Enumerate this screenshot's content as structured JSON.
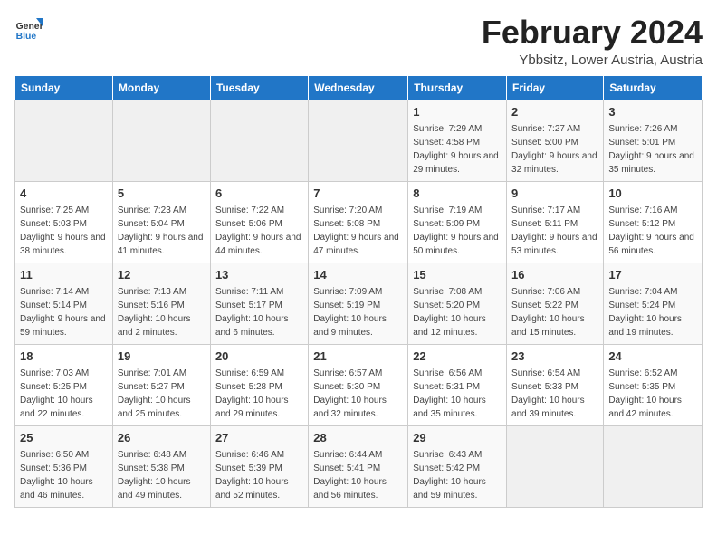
{
  "logo": {
    "general": "General",
    "blue": "Blue"
  },
  "header": {
    "month": "February 2024",
    "location": "Ybbsitz, Lower Austria, Austria"
  },
  "weekdays": [
    "Sunday",
    "Monday",
    "Tuesday",
    "Wednesday",
    "Thursday",
    "Friday",
    "Saturday"
  ],
  "weeks": [
    [
      {
        "day": "",
        "sunrise": "",
        "sunset": "",
        "daylight": "",
        "empty": true
      },
      {
        "day": "",
        "sunrise": "",
        "sunset": "",
        "daylight": "",
        "empty": true
      },
      {
        "day": "",
        "sunrise": "",
        "sunset": "",
        "daylight": "",
        "empty": true
      },
      {
        "day": "",
        "sunrise": "",
        "sunset": "",
        "daylight": "",
        "empty": true
      },
      {
        "day": "1",
        "sunrise": "Sunrise: 7:29 AM",
        "sunset": "Sunset: 4:58 PM",
        "daylight": "Daylight: 9 hours and 29 minutes."
      },
      {
        "day": "2",
        "sunrise": "Sunrise: 7:27 AM",
        "sunset": "Sunset: 5:00 PM",
        "daylight": "Daylight: 9 hours and 32 minutes."
      },
      {
        "day": "3",
        "sunrise": "Sunrise: 7:26 AM",
        "sunset": "Sunset: 5:01 PM",
        "daylight": "Daylight: 9 hours and 35 minutes."
      }
    ],
    [
      {
        "day": "4",
        "sunrise": "Sunrise: 7:25 AM",
        "sunset": "Sunset: 5:03 PM",
        "daylight": "Daylight: 9 hours and 38 minutes."
      },
      {
        "day": "5",
        "sunrise": "Sunrise: 7:23 AM",
        "sunset": "Sunset: 5:04 PM",
        "daylight": "Daylight: 9 hours and 41 minutes."
      },
      {
        "day": "6",
        "sunrise": "Sunrise: 7:22 AM",
        "sunset": "Sunset: 5:06 PM",
        "daylight": "Daylight: 9 hours and 44 minutes."
      },
      {
        "day": "7",
        "sunrise": "Sunrise: 7:20 AM",
        "sunset": "Sunset: 5:08 PM",
        "daylight": "Daylight: 9 hours and 47 minutes."
      },
      {
        "day": "8",
        "sunrise": "Sunrise: 7:19 AM",
        "sunset": "Sunset: 5:09 PM",
        "daylight": "Daylight: 9 hours and 50 minutes."
      },
      {
        "day": "9",
        "sunrise": "Sunrise: 7:17 AM",
        "sunset": "Sunset: 5:11 PM",
        "daylight": "Daylight: 9 hours and 53 minutes."
      },
      {
        "day": "10",
        "sunrise": "Sunrise: 7:16 AM",
        "sunset": "Sunset: 5:12 PM",
        "daylight": "Daylight: 9 hours and 56 minutes."
      }
    ],
    [
      {
        "day": "11",
        "sunrise": "Sunrise: 7:14 AM",
        "sunset": "Sunset: 5:14 PM",
        "daylight": "Daylight: 9 hours and 59 minutes."
      },
      {
        "day": "12",
        "sunrise": "Sunrise: 7:13 AM",
        "sunset": "Sunset: 5:16 PM",
        "daylight": "Daylight: 10 hours and 2 minutes."
      },
      {
        "day": "13",
        "sunrise": "Sunrise: 7:11 AM",
        "sunset": "Sunset: 5:17 PM",
        "daylight": "Daylight: 10 hours and 6 minutes."
      },
      {
        "day": "14",
        "sunrise": "Sunrise: 7:09 AM",
        "sunset": "Sunset: 5:19 PM",
        "daylight": "Daylight: 10 hours and 9 minutes."
      },
      {
        "day": "15",
        "sunrise": "Sunrise: 7:08 AM",
        "sunset": "Sunset: 5:20 PM",
        "daylight": "Daylight: 10 hours and 12 minutes."
      },
      {
        "day": "16",
        "sunrise": "Sunrise: 7:06 AM",
        "sunset": "Sunset: 5:22 PM",
        "daylight": "Daylight: 10 hours and 15 minutes."
      },
      {
        "day": "17",
        "sunrise": "Sunrise: 7:04 AM",
        "sunset": "Sunset: 5:24 PM",
        "daylight": "Daylight: 10 hours and 19 minutes."
      }
    ],
    [
      {
        "day": "18",
        "sunrise": "Sunrise: 7:03 AM",
        "sunset": "Sunset: 5:25 PM",
        "daylight": "Daylight: 10 hours and 22 minutes."
      },
      {
        "day": "19",
        "sunrise": "Sunrise: 7:01 AM",
        "sunset": "Sunset: 5:27 PM",
        "daylight": "Daylight: 10 hours and 25 minutes."
      },
      {
        "day": "20",
        "sunrise": "Sunrise: 6:59 AM",
        "sunset": "Sunset: 5:28 PM",
        "daylight": "Daylight: 10 hours and 29 minutes."
      },
      {
        "day": "21",
        "sunrise": "Sunrise: 6:57 AM",
        "sunset": "Sunset: 5:30 PM",
        "daylight": "Daylight: 10 hours and 32 minutes."
      },
      {
        "day": "22",
        "sunrise": "Sunrise: 6:56 AM",
        "sunset": "Sunset: 5:31 PM",
        "daylight": "Daylight: 10 hours and 35 minutes."
      },
      {
        "day": "23",
        "sunrise": "Sunrise: 6:54 AM",
        "sunset": "Sunset: 5:33 PM",
        "daylight": "Daylight: 10 hours and 39 minutes."
      },
      {
        "day": "24",
        "sunrise": "Sunrise: 6:52 AM",
        "sunset": "Sunset: 5:35 PM",
        "daylight": "Daylight: 10 hours and 42 minutes."
      }
    ],
    [
      {
        "day": "25",
        "sunrise": "Sunrise: 6:50 AM",
        "sunset": "Sunset: 5:36 PM",
        "daylight": "Daylight: 10 hours and 46 minutes."
      },
      {
        "day": "26",
        "sunrise": "Sunrise: 6:48 AM",
        "sunset": "Sunset: 5:38 PM",
        "daylight": "Daylight: 10 hours and 49 minutes."
      },
      {
        "day": "27",
        "sunrise": "Sunrise: 6:46 AM",
        "sunset": "Sunset: 5:39 PM",
        "daylight": "Daylight: 10 hours and 52 minutes."
      },
      {
        "day": "28",
        "sunrise": "Sunrise: 6:44 AM",
        "sunset": "Sunset: 5:41 PM",
        "daylight": "Daylight: 10 hours and 56 minutes."
      },
      {
        "day": "29",
        "sunrise": "Sunrise: 6:43 AM",
        "sunset": "Sunset: 5:42 PM",
        "daylight": "Daylight: 10 hours and 59 minutes."
      },
      {
        "day": "",
        "sunrise": "",
        "sunset": "",
        "daylight": "",
        "empty": true
      },
      {
        "day": "",
        "sunrise": "",
        "sunset": "",
        "daylight": "",
        "empty": true
      }
    ]
  ]
}
